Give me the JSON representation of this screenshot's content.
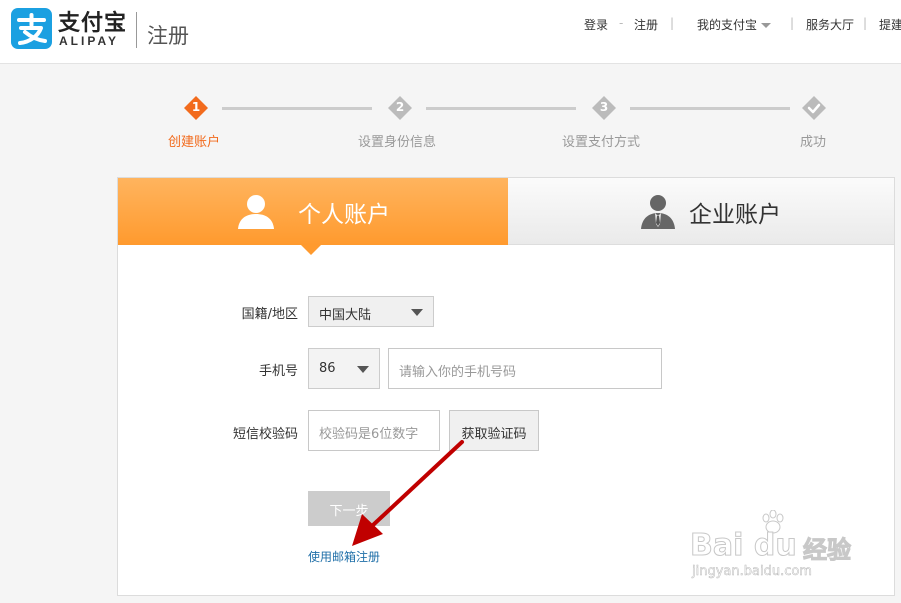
{
  "header": {
    "logo_cn": "支付宝",
    "logo_en": "ALIPAY",
    "title": "注册",
    "nav": {
      "login": "登录",
      "dash": "-",
      "register": "注册",
      "sep": "|",
      "my_alipay": "我的支付宝",
      "service_hall": "服务大厅",
      "more": "提建"
    }
  },
  "steps": [
    {
      "number": "1",
      "label": "创建账户",
      "state": "active"
    },
    {
      "number": "2",
      "label": "设置身份信息",
      "state": "pending"
    },
    {
      "number": "3",
      "label": "设置支付方式",
      "state": "pending"
    },
    {
      "number": "",
      "label": "成功",
      "state": "pending",
      "icon": "checkmark-icon"
    }
  ],
  "tabs": {
    "personal": "个人账户",
    "business": "企业账户"
  },
  "form": {
    "nationality_label": "国籍/地区",
    "nationality_value": "中国大陆",
    "phone_label": "手机号",
    "country_code": "86",
    "phone_placeholder": "请输入你的手机号码",
    "sms_label": "短信校验码",
    "sms_placeholder": "校验码是6位数字",
    "get_code_button": "获取验证码",
    "next_button": "下一步",
    "email_register_link": "使用邮箱注册"
  },
  "watermark": {
    "brand_latin": "Bai du",
    "brand_cn": "经验",
    "url": "jingyan.baidu.com"
  },
  "colors": {
    "brand_blue": "#1ba0e1",
    "accent_orange": "#ff9a2e",
    "step_active": "#f26b1d",
    "step_inactive": "#bbbbbb",
    "link_blue": "#1f6fa8",
    "annotation_arrow": "#c00000"
  }
}
